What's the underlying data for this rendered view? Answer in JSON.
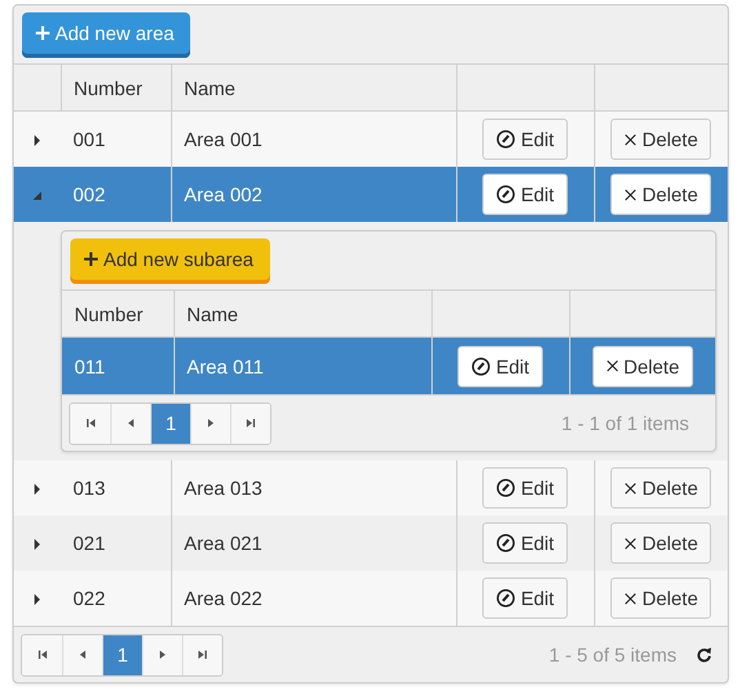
{
  "toolbar": {
    "add_button": "Add new area"
  },
  "columns": [
    "Number",
    "Name"
  ],
  "rows": [
    {
      "number": "001",
      "name": "Area 001",
      "expanded": false,
      "selected": false,
      "edit": "Edit",
      "delete": "Delete"
    },
    {
      "number": "002",
      "name": "Area 002",
      "expanded": true,
      "selected": true,
      "edit": "Edit",
      "delete": "Delete",
      "detail": {
        "add_button": "Add new subarea",
        "columns": [
          "Number",
          "Name"
        ],
        "rows": [
          {
            "number": "011",
            "name": "Area 011",
            "selected": true,
            "edit": "Edit",
            "delete": "Delete"
          }
        ],
        "pager": {
          "pages": [
            {
              "label": "1",
              "selected": true
            }
          ],
          "info": "1 - 1 of 1 items"
        }
      }
    },
    {
      "number": "013",
      "name": "Area 013",
      "expanded": false,
      "selected": false,
      "edit": "Edit",
      "delete": "Delete"
    },
    {
      "number": "021",
      "name": "Area 021",
      "expanded": false,
      "selected": false,
      "edit": "Edit",
      "delete": "Delete"
    },
    {
      "number": "022",
      "name": "Area 022",
      "expanded": false,
      "selected": false,
      "edit": "Edit",
      "delete": "Delete"
    }
  ],
  "pager": {
    "pages": [
      {
        "label": "1",
        "selected": true
      }
    ],
    "info": "1 - 5 of 5 items"
  }
}
